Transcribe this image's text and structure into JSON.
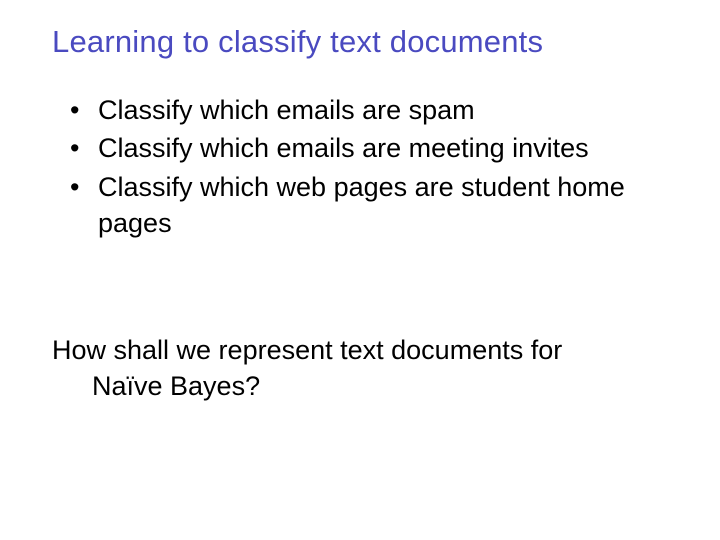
{
  "title": "Learning to classify text documents",
  "bullets": [
    "Classify which emails are spam",
    "Classify which emails are meeting invites",
    "Classify which web pages are student home pages"
  ],
  "question_line1": "How shall we represent text documents for",
  "question_line2": "Naïve Bayes?"
}
